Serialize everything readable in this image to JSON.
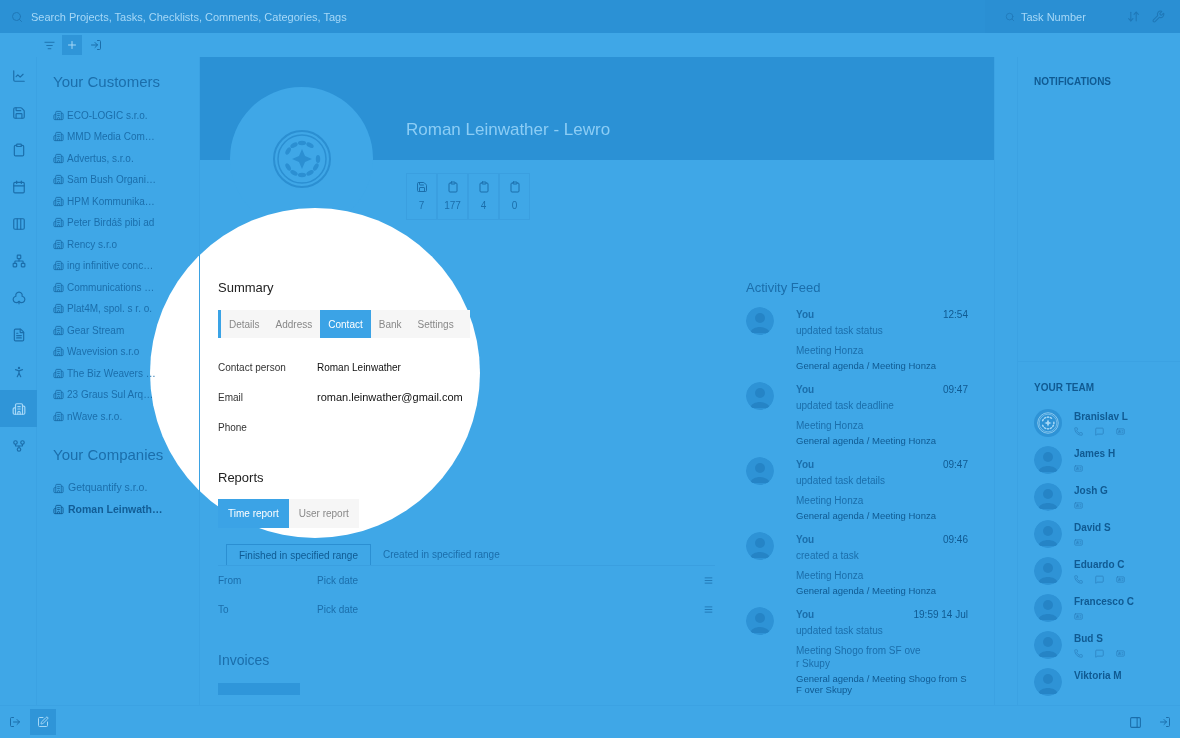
{
  "search": {
    "placeholder": "Search Projects, Tasks, Checklists, Comments, Categories, Tags"
  },
  "task_search": {
    "placeholder": "Task Number"
  },
  "rail": [
    {
      "kind": "chart",
      "selected": false
    },
    {
      "kind": "save",
      "selected": false
    },
    {
      "kind": "clipboard",
      "selected": false
    },
    {
      "kind": "calendar",
      "selected": false
    },
    {
      "kind": "columns",
      "selected": false
    },
    {
      "kind": "hierarchy",
      "selected": false
    },
    {
      "kind": "club",
      "selected": false
    },
    {
      "kind": "document",
      "selected": false
    },
    {
      "kind": "person",
      "selected": false
    },
    {
      "kind": "buildings",
      "selected": true
    },
    {
      "kind": "fork",
      "selected": false
    }
  ],
  "customers": {
    "title": "Your Customers",
    "items": [
      "ECO-LOGIC s.r.o.",
      "MMD Media Com…",
      "Advertus, s.r.o.",
      "Sam Bush Organi…",
      "HPM Kommunika…",
      "Peter Birdáš pibi ad",
      "Rency s.r.o",
      "ing infinitive conc…",
      "Communications …",
      "Plat4M, spol. s r. o.",
      "Gear Stream",
      "Wavevision s.r.o",
      "The Biz Weavers …",
      "23 Graus Sul Arq…",
      "nWave s.r.o."
    ]
  },
  "companies": {
    "title": "Your Companies",
    "items": [
      {
        "name": "Getquantify s.r.o.",
        "selected": false
      },
      {
        "name": "Roman Leinwath…",
        "selected": true
      }
    ]
  },
  "profile": {
    "title": "Roman Leinwather - Lewro",
    "stats": [
      {
        "kind": "save",
        "value": "7"
      },
      {
        "kind": "clipboard",
        "value": "177"
      },
      {
        "kind": "clipboard",
        "value": "4"
      },
      {
        "kind": "clipboard",
        "value": "0"
      }
    ]
  },
  "summary": {
    "title": "Summary",
    "tabs": [
      {
        "label": "Details",
        "selected": false
      },
      {
        "label": "Address",
        "selected": false
      },
      {
        "label": "Contact",
        "selected": true
      },
      {
        "label": "Bank",
        "selected": false
      },
      {
        "label": "Settings",
        "selected": false
      }
    ],
    "fields": [
      {
        "label": "Contact person",
        "value": "Roman Leinwather"
      },
      {
        "label": "Email",
        "value": "roman.leinwather@gmail.com"
      },
      {
        "label": "Phone"
      }
    ]
  },
  "reports": {
    "title": "Reports",
    "tabs": [
      {
        "label": "Time report",
        "selected": true
      },
      {
        "label": "User report",
        "selected": false
      }
    ],
    "range_tabs": [
      {
        "label": "Finished in specified range",
        "selected": true
      },
      {
        "label": "Created in specified range",
        "selected": false
      }
    ],
    "dates": [
      {
        "label": "From",
        "placeholder": "Pick date"
      },
      {
        "label": "To",
        "placeholder": "Pick date"
      }
    ]
  },
  "invoices": {
    "title": "Invoices"
  },
  "activity": {
    "title": "Activity Feed",
    "items": [
      {
        "who": "You",
        "time": "12:54",
        "action": "updated task status",
        "task": "Meeting Honza",
        "path": "General agenda / Meeting Honza"
      },
      {
        "who": "You",
        "time": "09:47",
        "action": "updated task deadline",
        "task": "Meeting Honza",
        "path": "General agenda / Meeting Honza"
      },
      {
        "who": "You",
        "time": "09:47",
        "action": "updated task details",
        "task": "Meeting Honza",
        "path": "General agenda / Meeting Honza"
      },
      {
        "who": "You",
        "time": "09:46",
        "action": "created a task",
        "task": "Meeting Honza",
        "path": "General agenda / Meeting Honza"
      },
      {
        "who": "You",
        "time": "19:59 14 Jul",
        "action": "updated task status",
        "task": "Meeting Shogo from SF over Skupy",
        "path": "General agenda / Meeting Shogo from SF over Skupy"
      }
    ]
  },
  "notifications": {
    "title": "NOTIFICATIONS"
  },
  "team": {
    "title": "YOUR TEAM",
    "members": [
      {
        "name": "Branislav L",
        "kind": "logo",
        "all_contacts": true
      },
      {
        "name": "James H",
        "kind": "person",
        "all_contacts": false
      },
      {
        "name": "Josh G",
        "kind": "person",
        "all_contacts": false
      },
      {
        "name": "David S",
        "kind": "person",
        "all_contacts": false
      },
      {
        "name": "Eduardo C",
        "kind": "person",
        "all_contacts": true
      },
      {
        "name": "Francesco C",
        "kind": "person",
        "all_contacts": false
      },
      {
        "name": "Bud S",
        "kind": "person",
        "all_contacts": true
      },
      {
        "name": "Viktoria M",
        "kind": "person"
      }
    ]
  }
}
